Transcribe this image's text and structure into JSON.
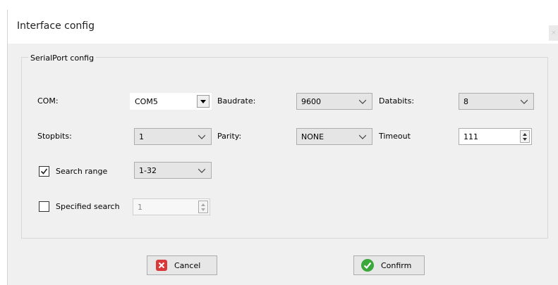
{
  "window": {
    "title": "Interface config",
    "close_glyph": "×"
  },
  "group": {
    "title": "SerialPort config"
  },
  "labels": {
    "com": "COM:",
    "baudrate": "Baudrate:",
    "databits": "Databits:",
    "stopbits": "Stopbits:",
    "parity": "Parity:",
    "timeout": "Timeout",
    "search_range": "Search range",
    "specified_search": "Specified search"
  },
  "values": {
    "com": "COM5",
    "baudrate": "9600",
    "databits": "8",
    "stopbits": "1",
    "parity": "NONE",
    "timeout": "111",
    "search_range": "1-32",
    "specified_search": "1"
  },
  "checkboxes": {
    "search_range_checked": true,
    "specified_search_checked": false
  },
  "buttons": {
    "cancel": "Cancel",
    "confirm": "Confirm"
  },
  "icons": {
    "cancel": "cancel-icon",
    "confirm": "confirm-check-icon",
    "dropdown": "chevron-down-icon"
  },
  "colors": {
    "cancel_icon": "#d9383a",
    "confirm_icon": "#3aa83a",
    "dialog_bg": "#f0f0f0"
  }
}
